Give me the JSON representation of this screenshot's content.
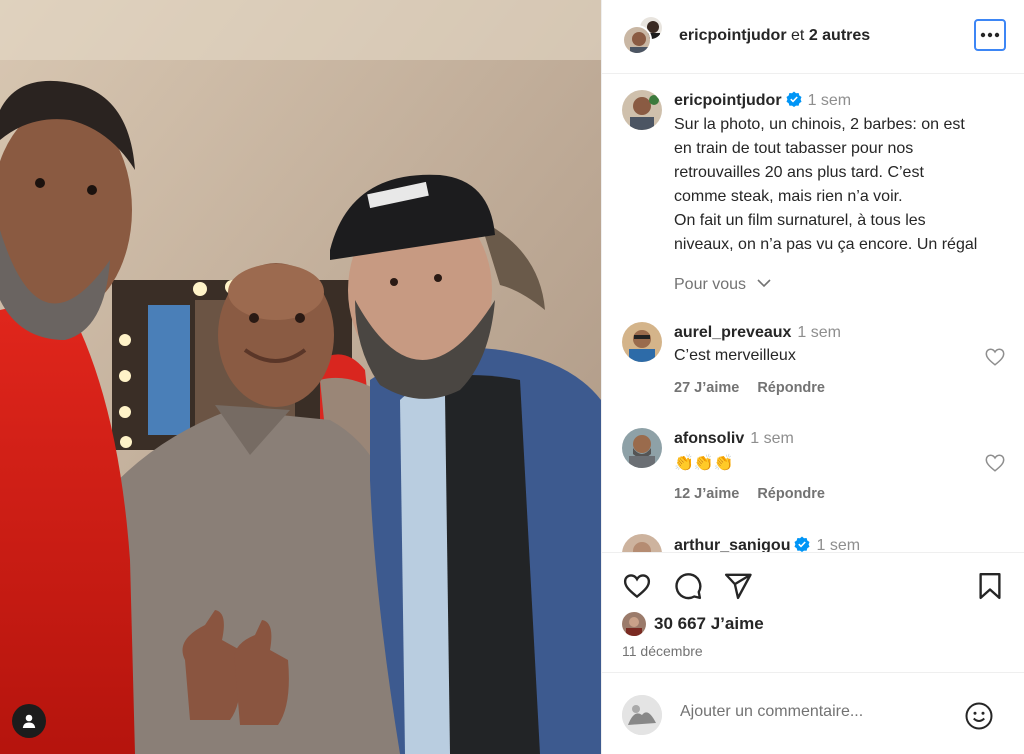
{
  "header": {
    "username": "ericpointjudor",
    "rest": "et",
    "others": "2 autres"
  },
  "caption": {
    "username": "ericpointjudor",
    "time": "1 sem",
    "lines": [
      "Sur la photo, un chinois, 2 barbes: on est",
      "en train de tout tabasser pour nos",
      "retrouvailles 20 ans plus tard. C’est",
      "comme steak, mais rien n’a voir.",
      "On fait un film surnaturel, à tous les",
      "niveaux, on n’a pas vu ça encore. Un régal"
    ],
    "pour_vous": "Pour vous"
  },
  "comments": [
    {
      "username": "aurel_preveaux",
      "time": "1 sem",
      "text": "C’est merveilleux",
      "likes": "27 J’aime",
      "reply": "Répondre"
    },
    {
      "username": "afonsoliv",
      "time": "1 sem",
      "text": "👏👏👏",
      "likes": "12 J’aime",
      "reply": "Répondre"
    },
    {
      "username": "arthur_sanigou",
      "time": "1 sem"
    }
  ],
  "likes": "30 667 J’aime",
  "date": "11 décembre",
  "add_comment": {
    "placeholder": "Ajouter un commentaire..."
  },
  "icons": {
    "more": "more-horizontal-icon",
    "like": "heart-icon",
    "comment": "comment-bubble-icon",
    "share": "paper-plane-icon",
    "save": "bookmark-icon",
    "emoji": "smiley-icon",
    "tag": "user-tag-icon",
    "verified": "verified-badge-icon"
  },
  "colors": {
    "accent": "#3d86f5",
    "verified": "#0095f6",
    "secondary_text": "#737373"
  }
}
